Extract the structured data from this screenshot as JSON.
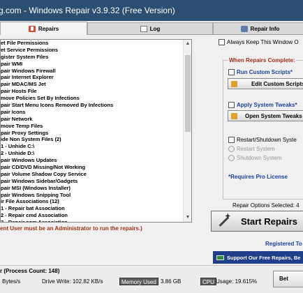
{
  "window": {
    "title": "g.com - Windows Repair v3.9.32 (Free Version)"
  },
  "tabs": [
    {
      "label": "Repairs",
      "icon": "repair-icon"
    },
    {
      "label": "Log",
      "icon": "log-icon"
    },
    {
      "label": "Repair Info",
      "icon": "info-icon"
    }
  ],
  "repairs": [
    "et File Permissions",
    "et Service Permissions",
    "gister System Files",
    "pair WMI",
    "pair Windows Firewall",
    "pair Internet Explorer",
    "pair MDAC/MS Jet",
    "pair Hosts File",
    "move Policies Set By Infections",
    "pair Start Menu Icons Removed By Infections",
    "pair Icons",
    "pair Network",
    "move Temp Files",
    "pair Proxy Settings",
    "ide Non System Files (2)",
    "1 - Unhide C:\\",
    "2 - Unhide D:\\",
    "pair Windows Updates",
    "pair CD/DVD Missing/Not Working",
    "pair Volume Shadow Copy Service",
    "pair Windows Sidebar/Gadgets",
    "pair MSI (Windows Installer)",
    "pair Windows Snipping Tool",
    "ir File Associations (12)",
    "1 - Repair bat Association",
    "2 - Repair cmd Association",
    "3 - Repair com Association"
  ],
  "admin_warning": "ent User must be an Administrator to run the repairs.)",
  "right_panel": {
    "always_keep": "Always Keep This Window O",
    "when_complete": "When Repairs Complete:",
    "run_custom_scripts": "Run Custom Scripts*",
    "edit_custom_scripts": "Edit Custom Scripts",
    "apply_system_tweaks": "Apply System Tweaks*",
    "open_system_tweaks": "Open System Tweaks",
    "restart_shutdown": "Restart/Shutdown Syste",
    "restart_system": "Restart System",
    "shutdown_system": "Shutdown System",
    "requires_pro": "*Requires Pro License",
    "repair_options_selected": "Repair Options Selected: 4",
    "start_repairs": "Start Repairs",
    "registered_to": "Registered To",
    "support_button": "Support Our Free Repairs, Be"
  },
  "status_bar": {
    "process_count_label": "r (Process Count: 148)",
    "read": "Bytes/s",
    "disk_write": "Drive Write: 102.82 KB/s",
    "memory_used_label": "Memory Used",
    "memory_used_value": "3.86 GB",
    "cpu_label": "CPU",
    "cpu_usage": "Usage: 19.615%",
    "beta_button": "Bet"
  }
}
